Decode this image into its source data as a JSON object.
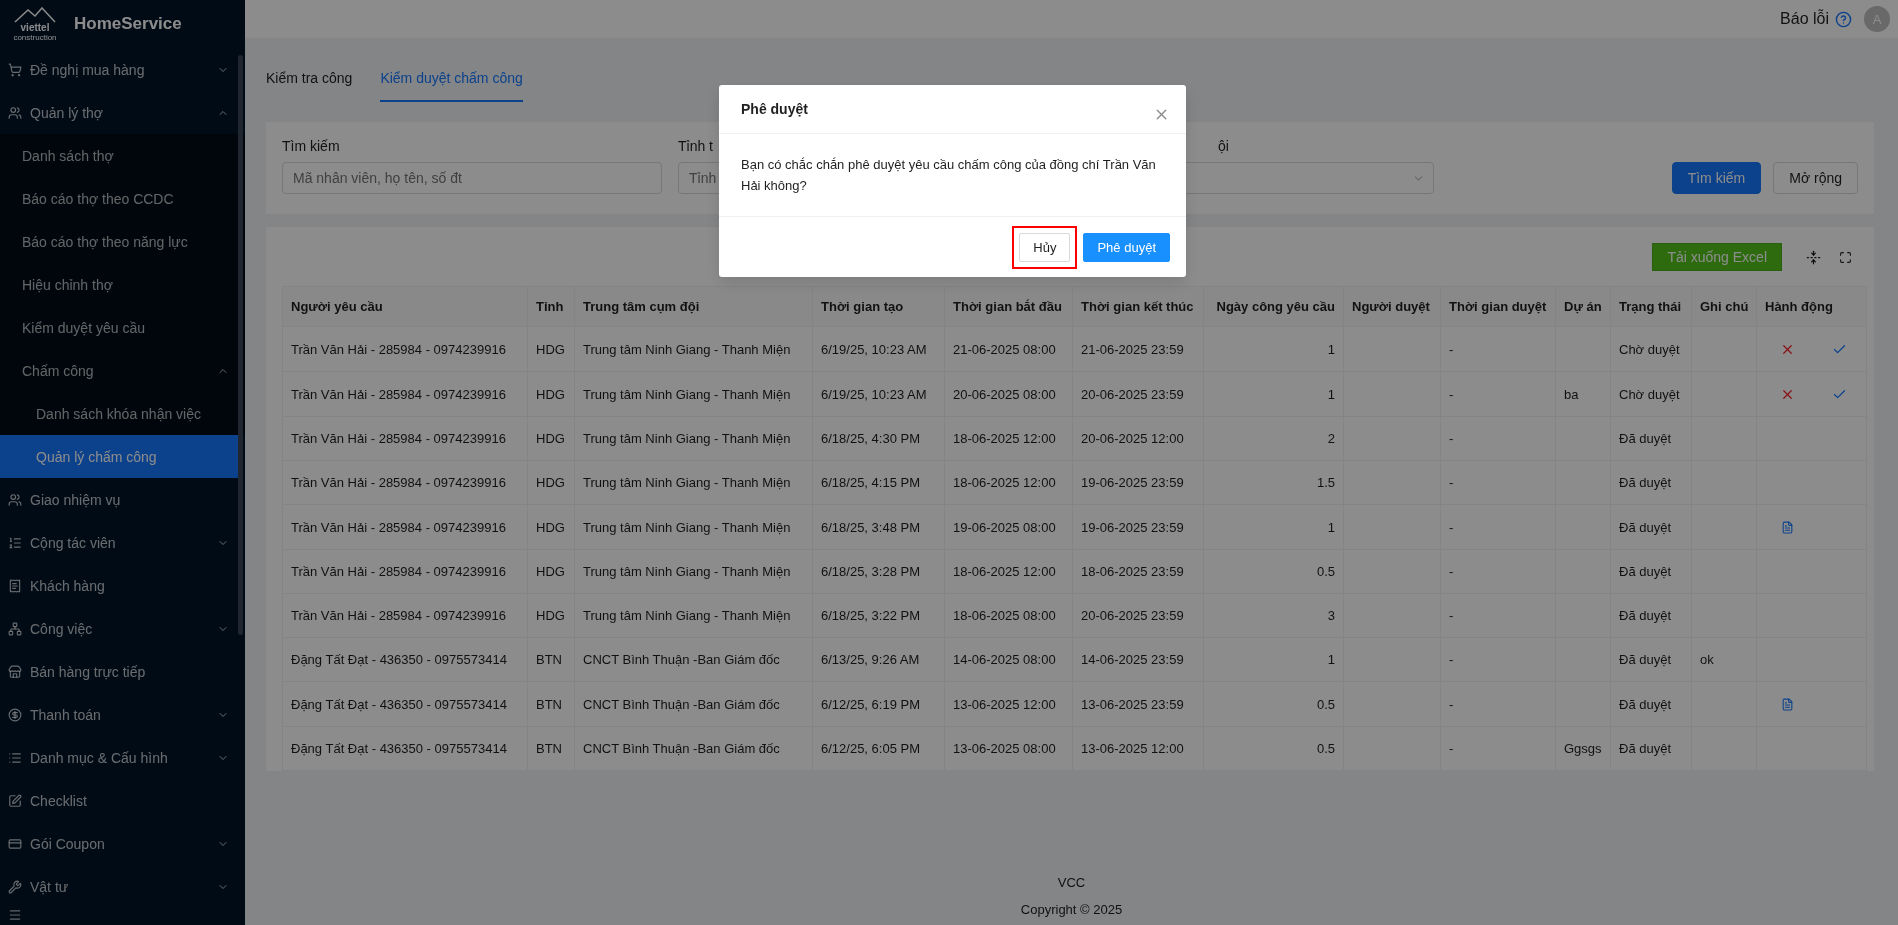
{
  "sidebar": {
    "logo_text": "viettel",
    "logo_subtext": "construction",
    "app_name": "HomeService",
    "items": [
      {
        "label": "Đề nghị mua hàng",
        "expanded": false,
        "selected": false
      },
      {
        "label": "Quản lý thợ",
        "expanded": true,
        "selected": false,
        "children": [
          {
            "label": "Danh sách thợ",
            "selected": false
          },
          {
            "label": "Báo cáo thợ theo CCDC",
            "selected": false
          },
          {
            "label": "Báo cáo thợ theo năng lực",
            "selected": false
          },
          {
            "label": "Hiệu chỉnh thợ",
            "selected": false
          },
          {
            "label": "Kiểm duyệt yêu cầu",
            "selected": false
          },
          {
            "label": "Chấm công",
            "expanded": true,
            "selected": false,
            "children": [
              {
                "label": "Danh sách khóa nhận việc",
                "selected": false
              },
              {
                "label": "Quản lý chấm công",
                "selected": true
              }
            ]
          }
        ]
      },
      {
        "label": "Giao nhiệm vụ",
        "selected": false
      },
      {
        "label": "Cộng tác viên",
        "expanded": false,
        "selected": false
      },
      {
        "label": "Khách hàng",
        "selected": false
      },
      {
        "label": "Công việc",
        "expanded": false,
        "selected": false
      },
      {
        "label": "Bán hàng trực tiếp",
        "selected": false
      },
      {
        "label": "Thanh toán",
        "expanded": false,
        "selected": false
      },
      {
        "label": "Danh mục & Cấu hình",
        "expanded": false,
        "selected": false
      },
      {
        "label": "Checklist",
        "selected": false
      },
      {
        "label": "Gói Coupon",
        "expanded": false,
        "selected": false
      },
      {
        "label": "Vật tư",
        "expanded": false,
        "selected": false
      }
    ]
  },
  "header": {
    "report_link": "Báo lỗi",
    "avatar": "A"
  },
  "tabs": [
    {
      "label": "Kiểm tra công",
      "selected": false
    },
    {
      "label": "Kiểm duyệt chấm công",
      "selected": true
    }
  ],
  "filters": {
    "search_label": "Tìm kiếm",
    "search_placeholder": "Mã nhân viên, họ tên, số đt",
    "province_label": "Tỉnh t",
    "province_placeholder": "Tỉnh",
    "team_label": "ội",
    "search_button": "Tìm kiếm",
    "expand_button": "Mở rộng"
  },
  "toolbar": {
    "excel_button": "Tải xuống Excel"
  },
  "table": {
    "columns": [
      "Người yêu cầu",
      "Tỉnh",
      "Trung tâm cụm đội",
      "Thời gian tạo",
      "Thời gian bắt đầu",
      "Thời gian kết thúc",
      "Ngày công yêu cầu",
      "Người duyệt",
      "Thời gian duyệt",
      "Dự án",
      "Trạng thái",
      "Ghi chú",
      "Hành động"
    ],
    "rows": [
      {
        "cells": [
          "Trần Văn Hải - 285984 - 0974239916",
          "HDG",
          "Trung tâm Ninh Giang - Thanh Miện",
          "6/19/25, 10:23 AM",
          "21-06-2025 08:00",
          "21-06-2025 23:59",
          "1",
          "",
          "-",
          "",
          "Chờ duyệt",
          ""
        ],
        "actions": [
          {
            "kind": "reject"
          },
          {
            "kind": "approve"
          }
        ]
      },
      {
        "cells": [
          "Trần Văn Hải - 285984 - 0974239916",
          "HDG",
          "Trung tâm Ninh Giang - Thanh Miện",
          "6/19/25, 10:23 AM",
          "20-06-2025 08:00",
          "20-06-2025 23:59",
          "1",
          "",
          "-",
          "ba",
          "Chờ duyệt",
          ""
        ],
        "actions": [
          {
            "kind": "reject"
          },
          {
            "kind": "approve"
          }
        ]
      },
      {
        "cells": [
          "Trần Văn Hải - 285984 - 0974239916",
          "HDG",
          "Trung tâm Ninh Giang - Thanh Miện",
          "6/18/25, 4:30 PM",
          "18-06-2025 12:00",
          "20-06-2025 12:00",
          "2",
          "",
          "-",
          "",
          "Đã duyệt",
          ""
        ]
      },
      {
        "cells": [
          "Trần Văn Hải - 285984 - 0974239916",
          "HDG",
          "Trung tâm Ninh Giang - Thanh Miện",
          "6/18/25, 4:15 PM",
          "18-06-2025 12:00",
          "19-06-2025 23:59",
          "1.5",
          "",
          "-",
          "",
          "Đã duyệt",
          ""
        ]
      },
      {
        "cells": [
          "Trần Văn Hải - 285984 - 0974239916",
          "HDG",
          "Trung tâm Ninh Giang - Thanh Miện",
          "6/18/25, 3:48 PM",
          "19-06-2025 08:00",
          "19-06-2025 23:59",
          "1",
          "",
          "-",
          "",
          "Đã duyệt",
          ""
        ],
        "actions": [
          {
            "kind": "document"
          }
        ]
      },
      {
        "cells": [
          "Trần Văn Hải - 285984 - 0974239916",
          "HDG",
          "Trung tâm Ninh Giang - Thanh Miện",
          "6/18/25, 3:28 PM",
          "18-06-2025 12:00",
          "18-06-2025 23:59",
          "0.5",
          "",
          "-",
          "",
          "Đã duyệt",
          ""
        ]
      },
      {
        "cells": [
          "Trần Văn Hải - 285984 - 0974239916",
          "HDG",
          "Trung tâm Ninh Giang - Thanh Miện",
          "6/18/25, 3:22 PM",
          "18-06-2025 08:00",
          "20-06-2025 23:59",
          "3",
          "",
          "-",
          "",
          "Đã duyệt",
          ""
        ]
      },
      {
        "cells": [
          "Đặng Tất Đạt - 436350 - 0975573414",
          "BTN",
          "CNCT Bình Thuận -Ban Giám đốc",
          "6/13/25, 9:26 AM",
          "14-06-2025 08:00",
          "14-06-2025 23:59",
          "1",
          "",
          "-",
          "",
          "Đã duyệt",
          "ok"
        ]
      },
      {
        "cells": [
          "Đặng Tất Đạt - 436350 - 0975573414",
          "BTN",
          "CNCT Bình Thuận -Ban Giám đốc",
          "6/12/25, 6:19 PM",
          "13-06-2025 12:00",
          "13-06-2025 23:59",
          "0.5",
          "",
          "-",
          "",
          "Đã duyệt",
          ""
        ],
        "actions": [
          {
            "kind": "document"
          }
        ]
      },
      {
        "cells": [
          "Đặng Tất Đạt - 436350 - 0975573414",
          "BTN",
          "CNCT Bình Thuận -Ban Giám đốc",
          "6/12/25, 6:05 PM",
          "13-06-2025 08:00",
          "13-06-2025 12:00",
          "0.5",
          "",
          "-",
          "Ggsgs",
          "Đã duyệt",
          ""
        ]
      }
    ]
  },
  "footer": {
    "company": "VCC",
    "copyright": "Copyright © 2025"
  },
  "modal": {
    "title": "Phê duyệt",
    "message": "Bạn có chắc chắn phê duyệt yêu cầu chấm công của đồng chí Trần Văn Hải không?",
    "buttons": [
      {
        "label": "Hủy",
        "kind": "default",
        "highlighted": true
      },
      {
        "label": "Phê duyệt",
        "kind": "primary",
        "highlighted": false
      }
    ]
  }
}
